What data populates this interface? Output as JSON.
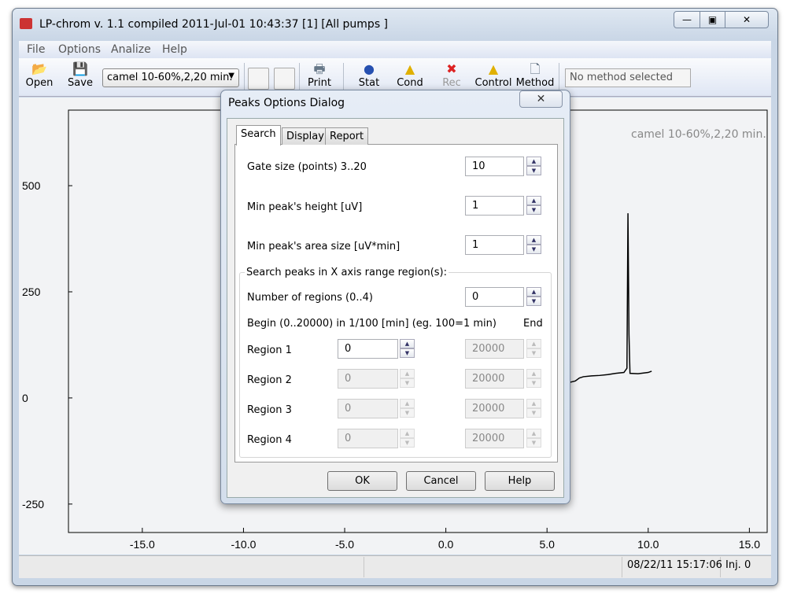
{
  "window": {
    "title": "LP-chrom v. 1.1 compiled 2011-Jul-01 10:43:37 [1] [All pumps ]",
    "minimize": "—",
    "maximize": "▣",
    "close": "✕"
  },
  "menu": [
    "File",
    "Options",
    "Analize",
    "Help"
  ],
  "toolbar": {
    "open": "Open",
    "save": "Save",
    "method_combo": "camel 10-60%,2,20 min.",
    "print": "Print",
    "stat": "Stat",
    "cond": "Cond",
    "rec": "Rec",
    "control": "Control",
    "method": "Method",
    "method_field": "No method selected"
  },
  "chart_data": {
    "type": "line",
    "title": "camel 10-60%,2,20 min.",
    "xlim": [
      -18.65,
      15.88
    ],
    "ylim": [
      -317,
      678
    ],
    "xticks": [
      -15,
      -10,
      -5,
      0,
      5,
      10,
      15
    ],
    "xtick_labels": [
      "-15.0",
      "-10.0",
      "-5.0",
      "0.0",
      "5.0",
      "10.0",
      "15.0"
    ],
    "yticks": [
      500,
      250,
      0,
      -250
    ],
    "ytick_labels": [
      "500",
      "250",
      "0",
      "-250"
    ],
    "series": [
      {
        "x": [
          6.15,
          6.4,
          6.6,
          6.8,
          7.2,
          7.6,
          8.0,
          8.4,
          8.8,
          8.95,
          9.0,
          9.05,
          9.1,
          9.5,
          10.0,
          10.17
        ],
        "y": [
          37,
          40,
          47,
          50,
          52,
          53,
          55,
          58,
          60,
          70,
          435,
          150,
          58,
          57,
          60,
          63
        ]
      }
    ]
  },
  "status": {
    "datetime": "08/22/11 15:17:06",
    "inj": "Inj. 0"
  },
  "dialog": {
    "title": "Peaks Options Dialog",
    "close": "✕",
    "tabs": [
      "Search",
      "Display",
      "Report"
    ],
    "gate_label": "Gate size (points) 3..20",
    "gate_value": "10",
    "height_label": "Min peak's height [uV]",
    "height_value": "1",
    "area_label": "Min peak's area size [uV*min]",
    "area_value": "1",
    "group_label": "Search peaks in X axis range region(s):",
    "regions_label": "Number of regions (0..4)",
    "regions_value": "0",
    "begin_label": "Begin (0..20000) in 1/100 [min] (eg. 100=1 min)",
    "end_label": "End",
    "regions": [
      {
        "label": "Region 1",
        "begin": "0",
        "end": "20000"
      },
      {
        "label": "Region 2",
        "begin": "0",
        "end": "20000"
      },
      {
        "label": "Region 3",
        "begin": "0",
        "end": "20000"
      },
      {
        "label": "Region 4",
        "begin": "0",
        "end": "20000"
      }
    ],
    "ok": "OK",
    "cancel": "Cancel",
    "help": "Help"
  }
}
